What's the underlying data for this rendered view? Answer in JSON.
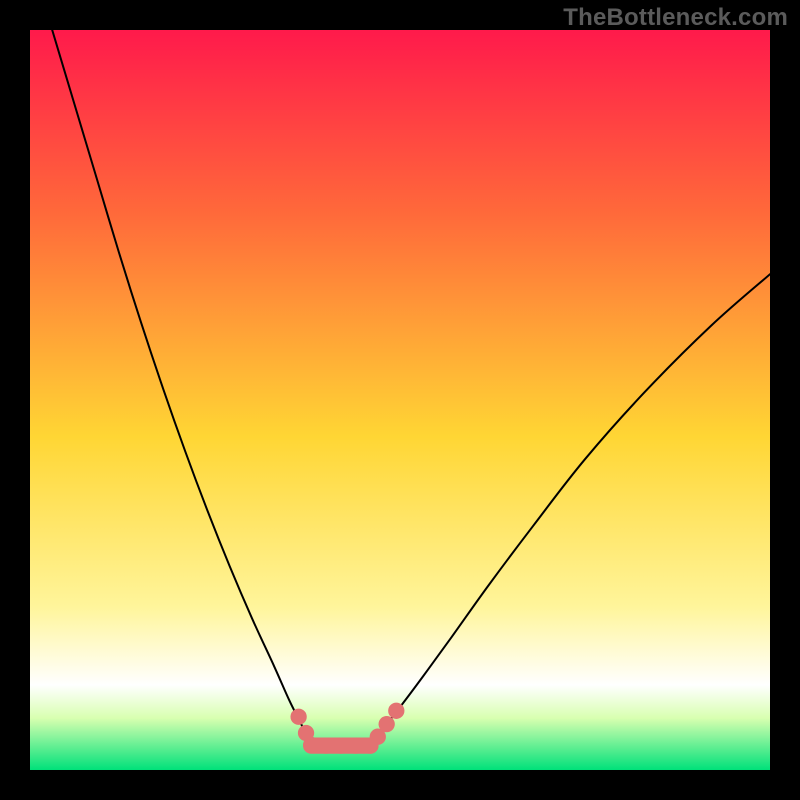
{
  "watermark": "TheBottleneck.com",
  "chart_data": {
    "type": "line",
    "title": "",
    "xlabel": "",
    "ylabel": "",
    "xlim": [
      0,
      100
    ],
    "ylim": [
      0,
      100
    ],
    "background_gradient": {
      "stops": [
        {
          "offset": 0,
          "color": "#ff1a4b"
        },
        {
          "offset": 0.25,
          "color": "#ff6a3a"
        },
        {
          "offset": 0.55,
          "color": "#ffd634"
        },
        {
          "offset": 0.78,
          "color": "#fff59b"
        },
        {
          "offset": 0.885,
          "color": "#ffffff"
        },
        {
          "offset": 0.93,
          "color": "#d8ffb0"
        },
        {
          "offset": 1.0,
          "color": "#00e17a"
        }
      ]
    },
    "series": [
      {
        "name": "left-branch",
        "x": [
          3,
          6,
          9,
          12,
          15,
          18,
          21,
          24,
          27,
          30,
          33,
          35,
          36.5,
          37.5
        ],
        "values": [
          100,
          90,
          80,
          70,
          60.5,
          51.5,
          43,
          35,
          27.5,
          20.5,
          14,
          9.5,
          6.5,
          4.5
        ]
      },
      {
        "name": "right-branch",
        "x": [
          46.5,
          48,
          50,
          53,
          57,
          62,
          68,
          75,
          83,
          92,
          100
        ],
        "values": [
          4.5,
          6,
          8.5,
          12.5,
          18,
          25,
          33,
          42,
          51,
          60,
          67
        ]
      },
      {
        "name": "flat-min",
        "x": [
          38,
          40,
          42,
          44,
          46
        ],
        "values": [
          3.3,
          3.3,
          3.3,
          3.3,
          3.3
        ]
      }
    ],
    "markers": {
      "name": "highlight-dots",
      "color": "#e37272",
      "radius_pct": 1.1,
      "points": [
        {
          "x": 36.3,
          "y": 7.2
        },
        {
          "x": 37.3,
          "y": 5.0
        },
        {
          "x": 38.0,
          "y": 3.4
        },
        {
          "x": 40.0,
          "y": 3.3
        },
        {
          "x": 42.0,
          "y": 3.3
        },
        {
          "x": 44.0,
          "y": 3.3
        },
        {
          "x": 46.0,
          "y": 3.3
        },
        {
          "x": 47.0,
          "y": 4.5
        },
        {
          "x": 48.2,
          "y": 6.2
        },
        {
          "x": 49.5,
          "y": 8.0
        }
      ]
    }
  }
}
